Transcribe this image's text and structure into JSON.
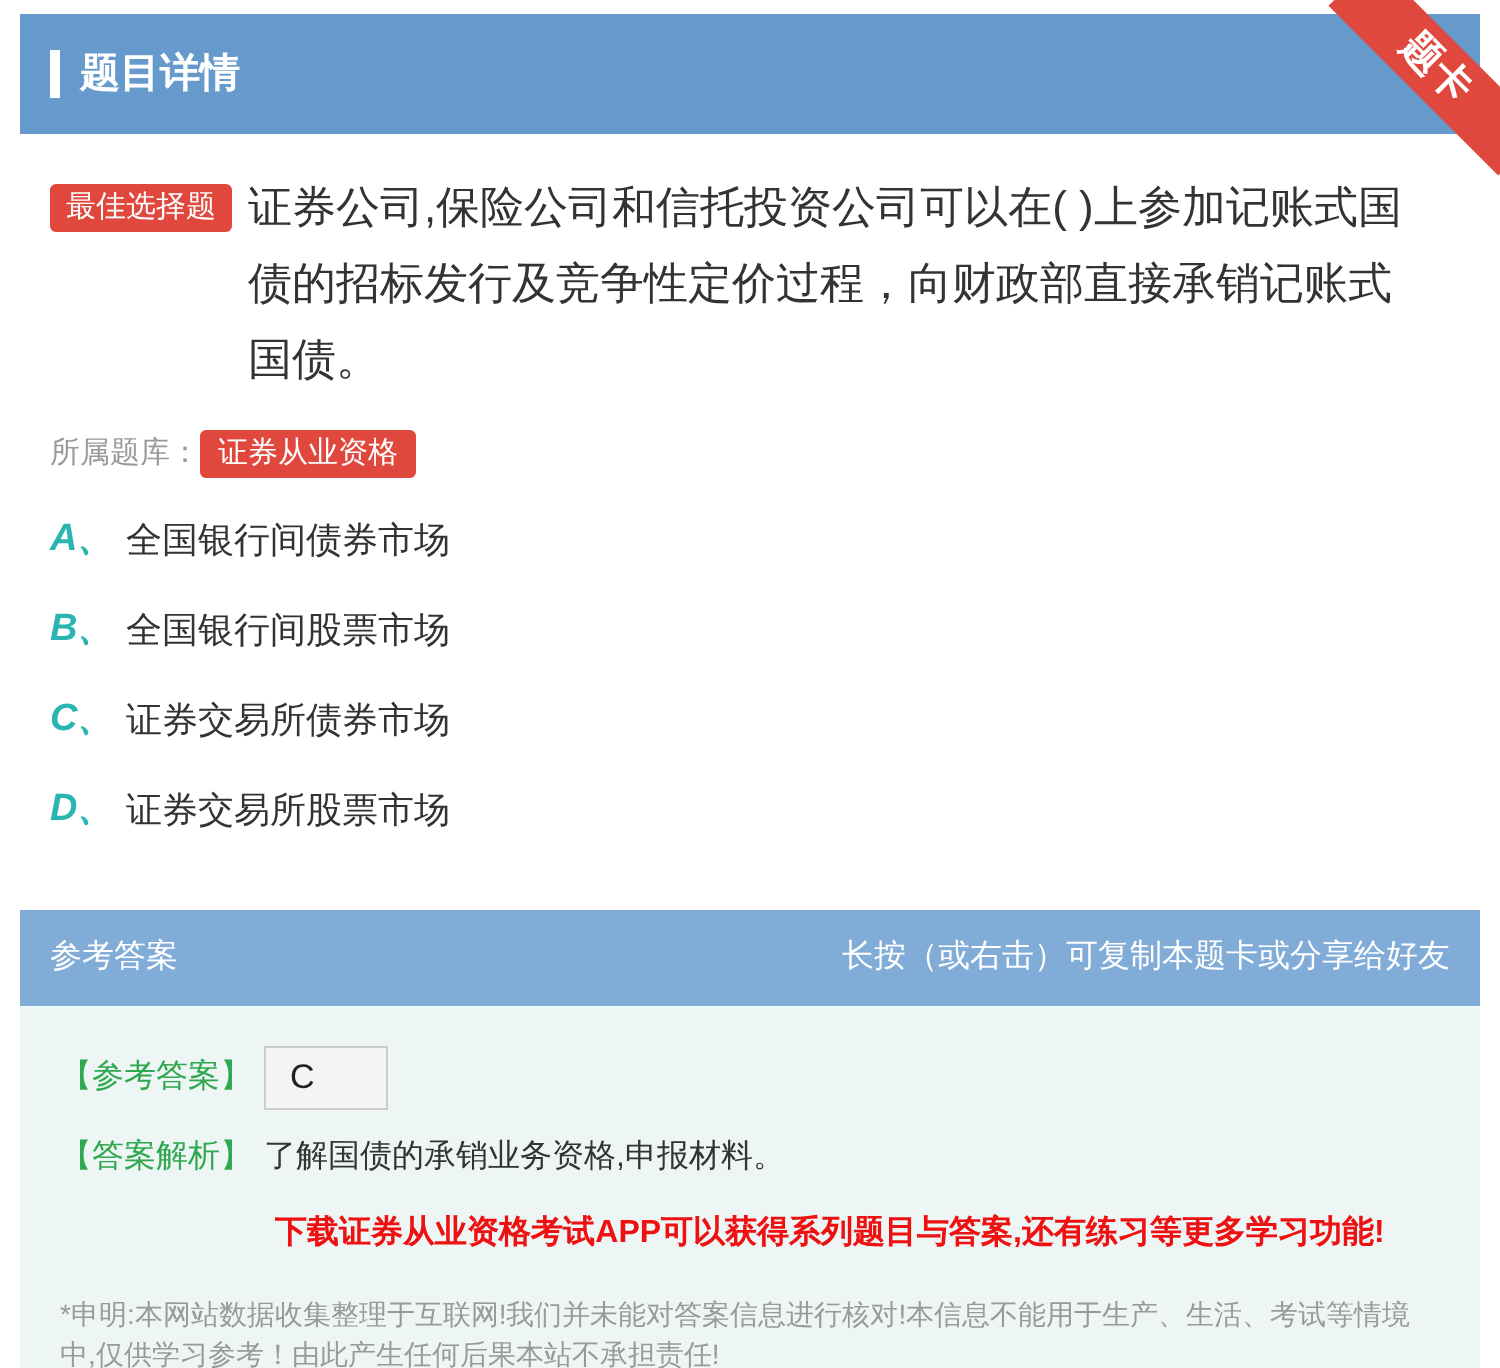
{
  "header": {
    "title": "题目详情",
    "ribbon": "题卡"
  },
  "question": {
    "type_badge": "最佳选择题",
    "text": "证券公司,保险公司和信托投资公司可以在( )上参加记账式国债的招标发行及竞争性定价过程，向财政部直接承销记账式国债。",
    "bank_label": "所属题库：",
    "bank": "证券从业资格"
  },
  "options": [
    {
      "letter": "A、",
      "text": "全国银行间债券市场"
    },
    {
      "letter": "B、",
      "text": "全国银行间股票市场"
    },
    {
      "letter": "C、",
      "text": "证券交易所债券市场"
    },
    {
      "letter": "D、",
      "text": "证券交易所股票市场"
    }
  ],
  "answer": {
    "title": "参考答案",
    "hint": "长按（或右击）可复制本题卡或分享给好友",
    "answer_label": "【参考答案】",
    "answer": "C",
    "analysis_label": "【答案解析】",
    "analysis": "了解国债的承销业务资格,申报材料。",
    "promo": "下载证券从业资格考试APP可以获得系列题目与答案,还有练习等更多学习功能!",
    "disclaimer": "*申明:本网站数据收集整理于互联网!我们并未能对答案信息进行核对!本信息不能用于生产、生活、考试等情境中,仅供学习参考！由此产生任何后果本站不承担责任!"
  }
}
